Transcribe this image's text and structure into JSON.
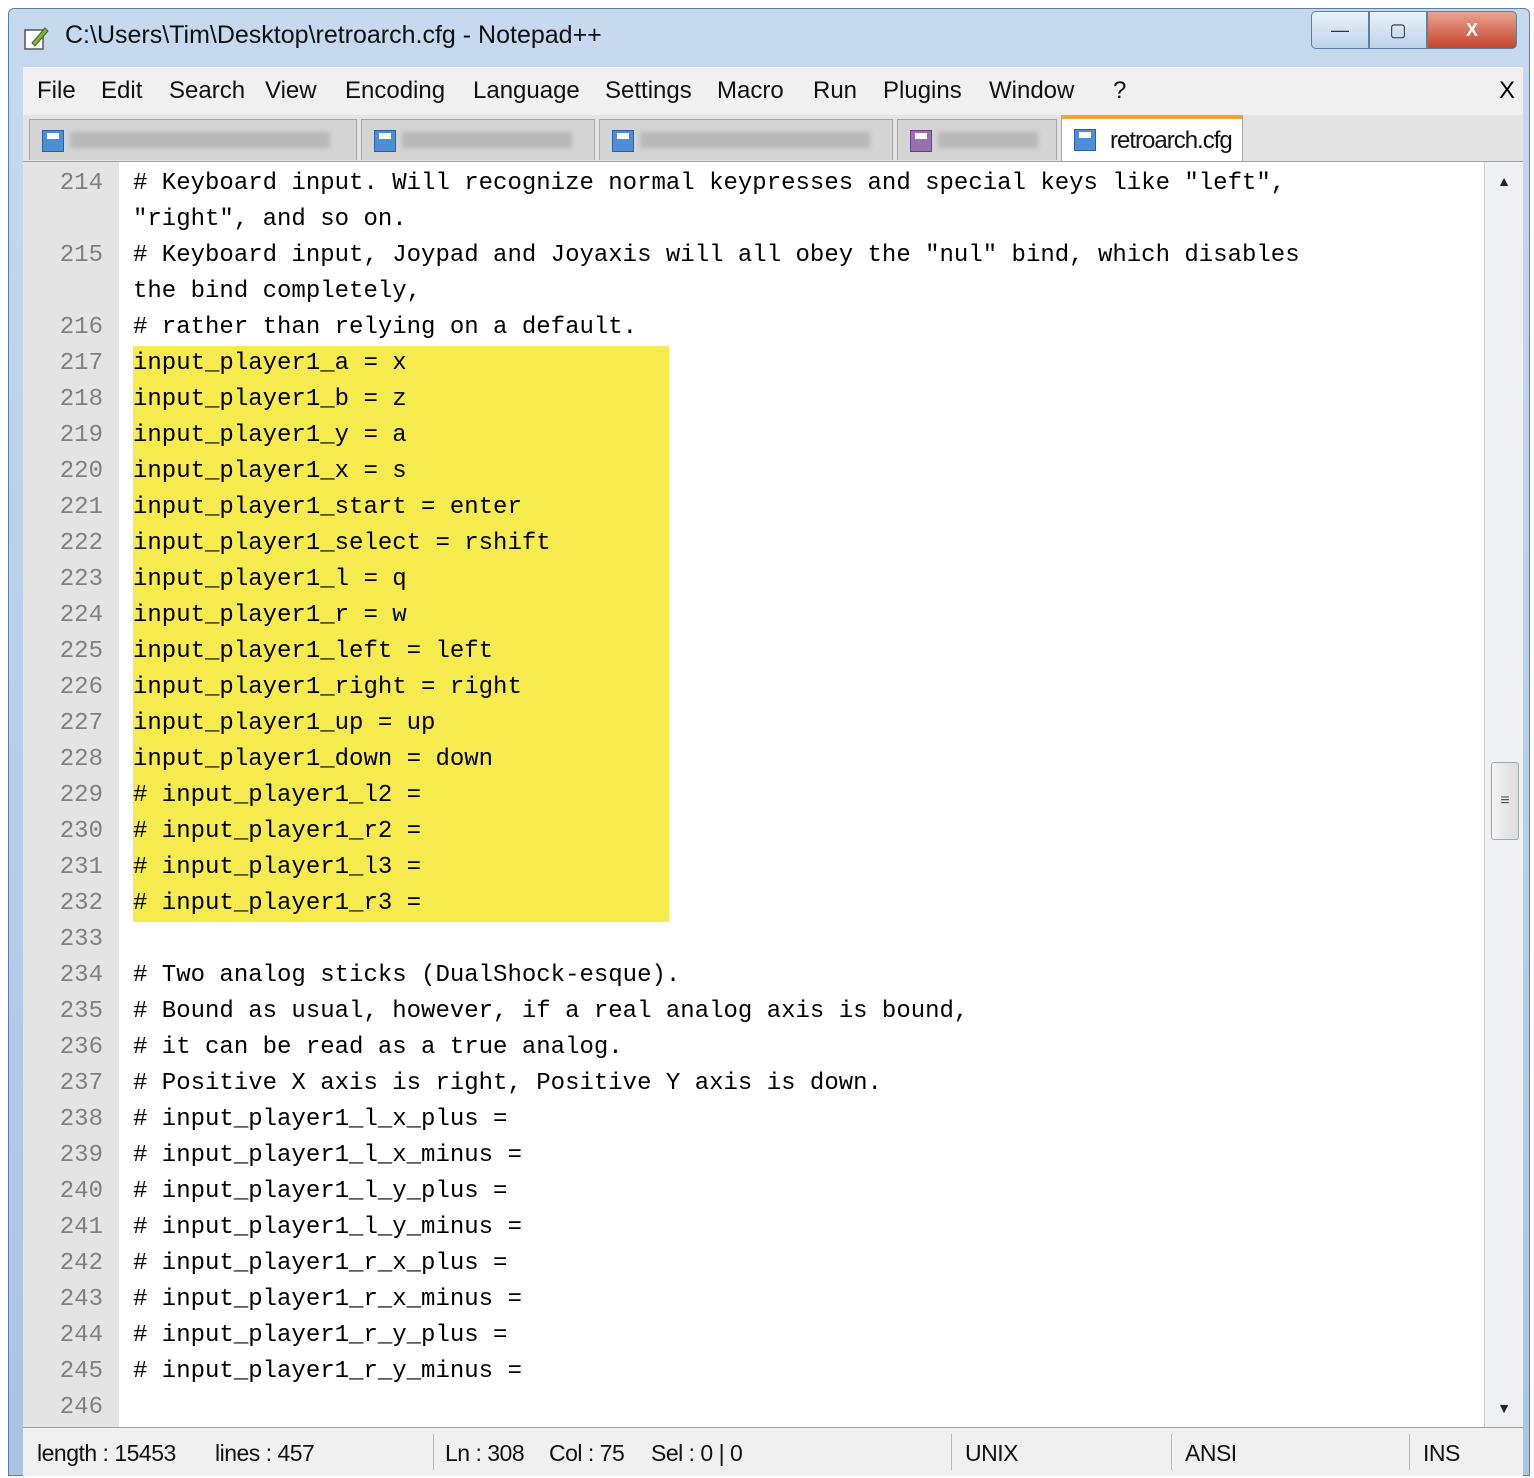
{
  "window": {
    "title": "C:\\Users\\Tim\\Desktop\\retroarch.cfg - Notepad++",
    "minimize": "—",
    "maximize": "▢",
    "close": "X"
  },
  "menu": {
    "items": [
      "File",
      "Edit",
      "Search",
      "View",
      "Encoding",
      "Language",
      "Settings",
      "Macro",
      "Run",
      "Plugins",
      "Window",
      "?"
    ],
    "close_doc": "X"
  },
  "tabs": {
    "active_label": "retroarch.cfg"
  },
  "editor": {
    "highlight_color": "#f5eb4f",
    "rows": [
      {
        "ln": "214",
        "text": "# Keyboard input. Will recognize normal keypresses and special keys like \"left\",",
        "hl": false
      },
      {
        "ln": "",
        "text": "\"right\", and so on.",
        "hl": false
      },
      {
        "ln": "215",
        "text": "# Keyboard input, Joypad and Joyaxis will all obey the \"nul\" bind, which disables",
        "hl": false
      },
      {
        "ln": "",
        "text": "the bind completely,",
        "hl": false
      },
      {
        "ln": "216",
        "text": "# rather than relying on a default.",
        "hl": false
      },
      {
        "ln": "217",
        "text": "input_player1_a = x",
        "hl": true
      },
      {
        "ln": "218",
        "text": "input_player1_b = z",
        "hl": true
      },
      {
        "ln": "219",
        "text": "input_player1_y = a",
        "hl": true
      },
      {
        "ln": "220",
        "text": "input_player1_x = s",
        "hl": true
      },
      {
        "ln": "221",
        "text": "input_player1_start = enter",
        "hl": true
      },
      {
        "ln": "222",
        "text": "input_player1_select = rshift",
        "hl": true
      },
      {
        "ln": "223",
        "text": "input_player1_l = q",
        "hl": true
      },
      {
        "ln": "224",
        "text": "input_player1_r = w",
        "hl": true
      },
      {
        "ln": "225",
        "text": "input_player1_left = left",
        "hl": true
      },
      {
        "ln": "226",
        "text": "input_player1_right = right",
        "hl": true
      },
      {
        "ln": "227",
        "text": "input_player1_up = up",
        "hl": true
      },
      {
        "ln": "228",
        "text": "input_player1_down = down",
        "hl": true
      },
      {
        "ln": "229",
        "text": "# input_player1_l2 =",
        "hl": true
      },
      {
        "ln": "230",
        "text": "# input_player1_r2 =",
        "hl": true
      },
      {
        "ln": "231",
        "text": "# input_player1_l3 =",
        "hl": true
      },
      {
        "ln": "232",
        "text": "# input_player1_r3 =",
        "hl": true
      },
      {
        "ln": "233",
        "text": "",
        "hl": false
      },
      {
        "ln": "234",
        "text": "# Two analog sticks (DualShock-esque).",
        "hl": false
      },
      {
        "ln": "235",
        "text": "# Bound as usual, however, if a real analog axis is bound,",
        "hl": false
      },
      {
        "ln": "236",
        "text": "# it can be read as a true analog.",
        "hl": false
      },
      {
        "ln": "237",
        "text": "# Positive X axis is right, Positive Y axis is down.",
        "hl": false
      },
      {
        "ln": "238",
        "text": "# input_player1_l_x_plus =",
        "hl": false
      },
      {
        "ln": "239",
        "text": "# input_player1_l_x_minus =",
        "hl": false
      },
      {
        "ln": "240",
        "text": "# input_player1_l_y_plus =",
        "hl": false
      },
      {
        "ln": "241",
        "text": "# input_player1_l_y_minus =",
        "hl": false
      },
      {
        "ln": "242",
        "text": "# input_player1_r_x_plus =",
        "hl": false
      },
      {
        "ln": "243",
        "text": "# input_player1_r_x_minus =",
        "hl": false
      },
      {
        "ln": "244",
        "text": "# input_player1_r_y_plus =",
        "hl": false
      },
      {
        "ln": "245",
        "text": "# input_player1_r_y_minus =",
        "hl": false
      },
      {
        "ln": "246",
        "text": "",
        "hl": false
      }
    ]
  },
  "scrollbar": {
    "up_icon": "▲",
    "down_icon": "▼",
    "thumb_grip": "≡"
  },
  "status": {
    "length": "length : 15453",
    "lines": "lines : 457",
    "ln": "Ln : 308",
    "col": "Col : 75",
    "sel": "Sel : 0 | 0",
    "eol": "UNIX",
    "encoding": "ANSI",
    "mode": "INS"
  }
}
